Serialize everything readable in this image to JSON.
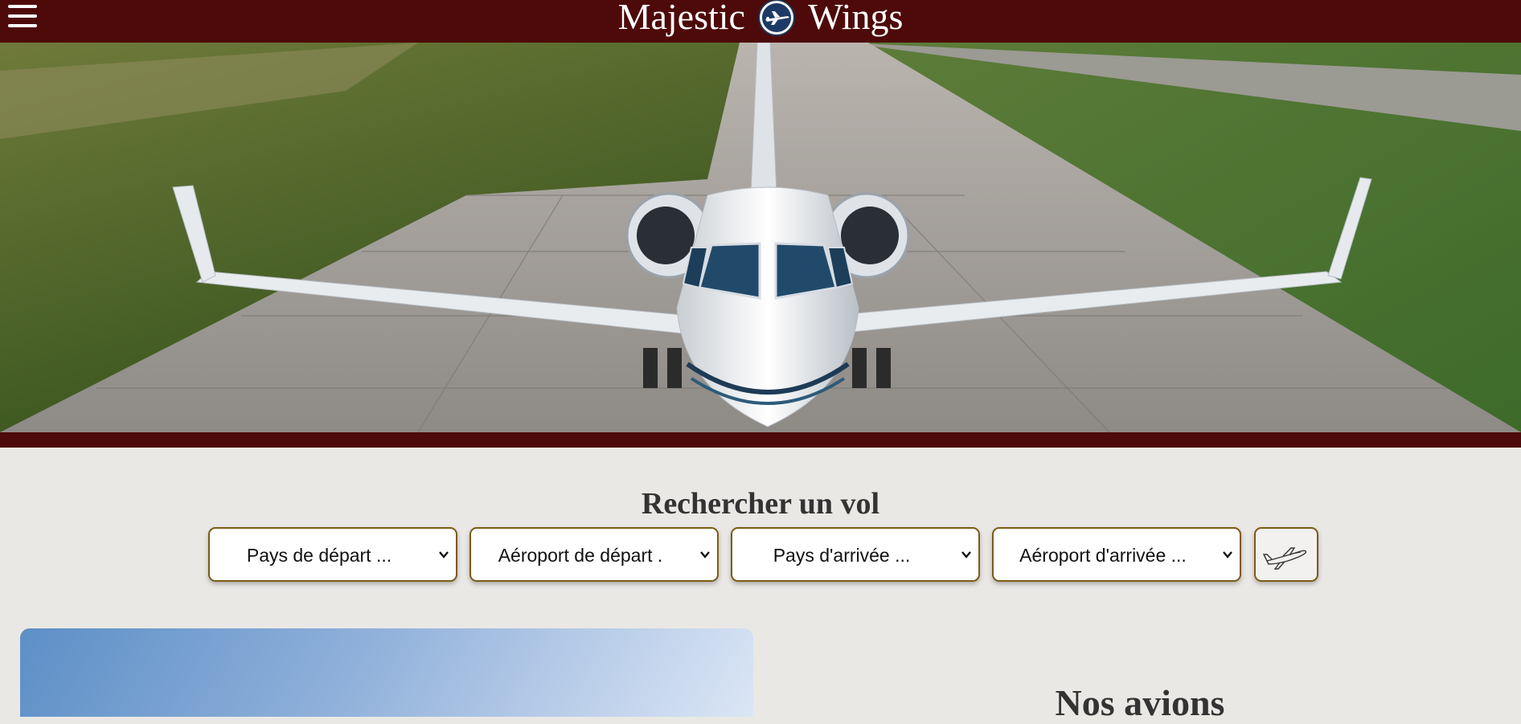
{
  "header": {
    "brand_left": "Majestic",
    "brand_right": "Wings",
    "menu_icon": "hamburger-menu-icon",
    "logo_icon": "plane-emblem-icon",
    "background": "#4e0a0a"
  },
  "search": {
    "title": "Rechercher un vol",
    "departure_country": "Pays de départ ...",
    "departure_airport": "Aéroport de départ .",
    "arrival_country": "Pays d'arrivée ...",
    "arrival_airport": "Aéroport d'arrivée ...",
    "submit_icon": "airplane-icon",
    "border_color": "#7a5c14"
  },
  "aircraft_section": {
    "title": "Nos avions"
  }
}
